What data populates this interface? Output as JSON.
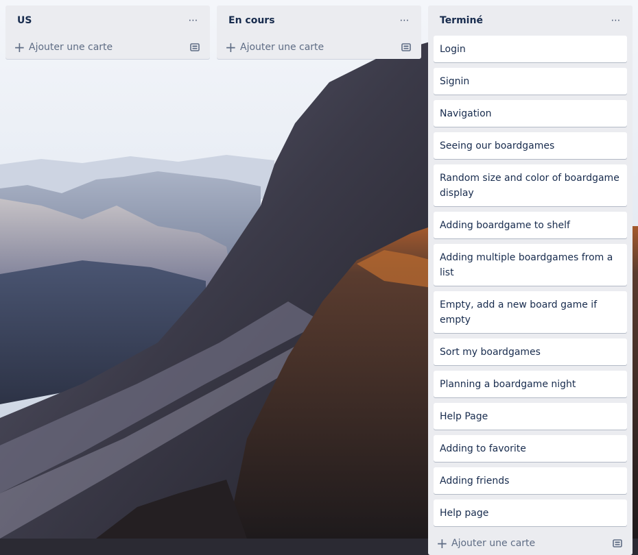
{
  "lists": [
    {
      "title": "US",
      "menu_icon": "ellipsis-icon",
      "cards": [],
      "add_card_label": "Ajouter une carte"
    },
    {
      "title": "En cours",
      "menu_icon": "ellipsis-icon",
      "cards": [],
      "add_card_label": "Ajouter une carte"
    },
    {
      "title": "Terminé",
      "menu_icon": "ellipsis-icon",
      "cards": [
        "Login",
        "Signin",
        "Navigation",
        "Seeing our boardgames",
        "Random size and color of boardgame display",
        "Adding boardgame to shelf",
        "Adding multiple boardgames from a list",
        "Empty, add a new board game if empty",
        "Sort my boardgames",
        "Planning a boardgame night",
        "Help Page",
        "Adding to favorite",
        "Adding friends",
        "Help page"
      ],
      "add_card_label": "Ajouter une carte"
    }
  ],
  "icons": {
    "menu": "⋯",
    "add": "+"
  },
  "colors": {
    "list_bg": "#ebecf0",
    "card_bg": "#ffffff",
    "text": "#172b4d",
    "muted": "#5e6c84"
  }
}
